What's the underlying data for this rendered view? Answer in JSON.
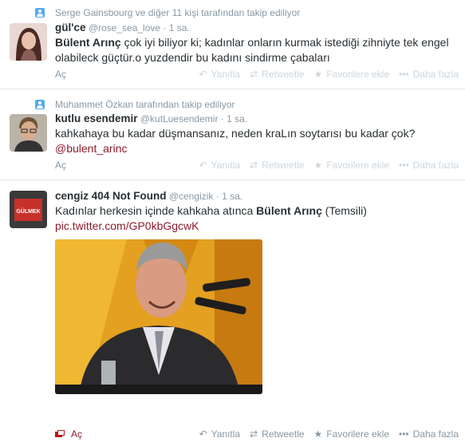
{
  "tweets": [
    {
      "context": "Serge Gainsbourg ve diğer 11 kişi tarafından takip ediliyor",
      "fullname": "gül'ce",
      "username": "@rose_sea_love",
      "time": "1 sa.",
      "text_bold": "Bülent Arınç",
      "text_rest": " çok iyi biliyor ki; kadınlar onların kurmak istediği zihniyte tek engel olabileck güçtür.o yuzdendir bu kadını sindirme çabaları",
      "expand": "Aç"
    },
    {
      "context": "Muhammet Özkan tarafından takip ediliyor",
      "fullname": "kutlu esendemir",
      "username": "@kutLuesendemir",
      "time": "1 sa.",
      "text": "kahkahaya bu kadar düşmansanız, neden kraLın soytarısı bu kadar çok?",
      "mention": "@bulent_arinc",
      "expand": "Aç"
    },
    {
      "fullname": "cengiz 404 Not Found",
      "username": "@cengizik",
      "time": "1 sa.",
      "text_pre": "Kadınlar herkesin içinde kahkaha atınca ",
      "text_bold": "Bülent Arınç",
      "text_post": " (Temsili)",
      "pic_link": "pic.twitter.com/GP0kbGgcwK",
      "expand": "Aç"
    }
  ],
  "actions": {
    "reply": "Yanıtla",
    "retweet": "Retweetle",
    "favorite": "Favorilere ekle",
    "more": "Daha fazla"
  },
  "avatar3_text": "GÜLMEK"
}
